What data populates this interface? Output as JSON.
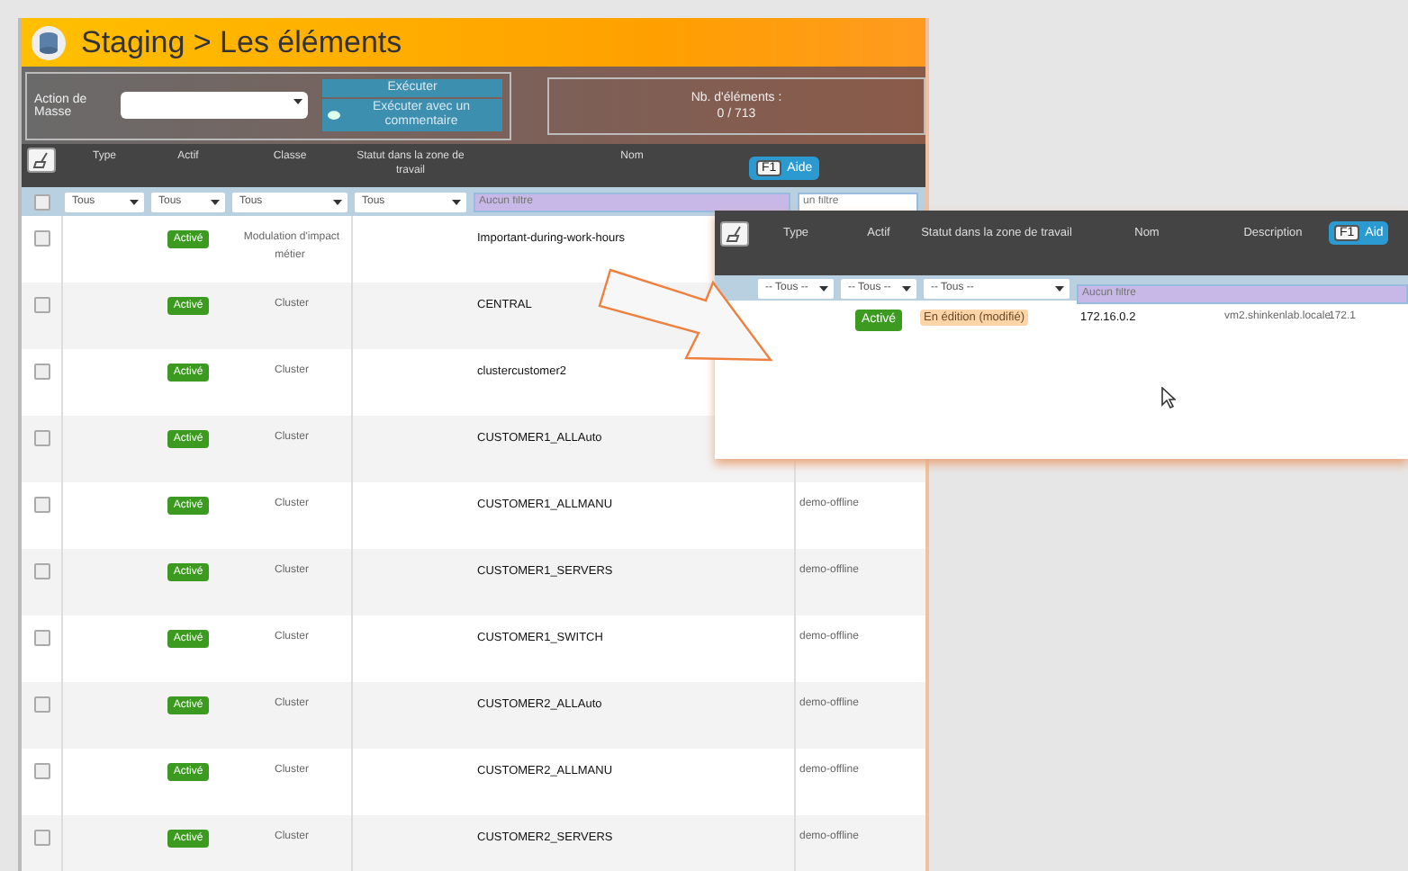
{
  "page_title": "Staging > Les éléments",
  "mass_action": {
    "label": "Action de Masse",
    "buttons": [
      "Exécuter",
      "Exécuter avec un commentaire"
    ]
  },
  "count": {
    "label": "Nb. d'éléments :",
    "value": "0 / 713"
  },
  "table": {
    "columns": [
      "Type",
      "Actif",
      "Classe",
      "Statut dans la zone de travail",
      "Nom"
    ],
    "help_button": {
      "key": "F1",
      "label": "Aide"
    },
    "select_all_checked": false,
    "filters": [
      {
        "kind": "select",
        "text": "Tous"
      },
      {
        "kind": "select",
        "text": "Tous"
      },
      {
        "kind": "select",
        "text": "Tous"
      },
      {
        "kind": "select",
        "text": "Tous"
      },
      {
        "kind": "text",
        "placeholder": "Aucun filtre"
      },
      {
        "kind": "text",
        "placeholder": "un filtre"
      }
    ],
    "rows": [
      {
        "checked": false,
        "active": "Activé",
        "class": "Modulation d'impact métier",
        "name": "Important-during-work-hours"
      },
      {
        "checked": false,
        "active": "Activé",
        "class": "Cluster",
        "name": "CENTRAL"
      },
      {
        "checked": false,
        "active": "Activé",
        "class": "Cluster",
        "name": "clustercustomer2"
      },
      {
        "checked": false,
        "active": "Activé",
        "class": "Cluster",
        "name": "CUSTOMER1_ALLAuto"
      },
      {
        "checked": false,
        "active": "Activé",
        "class": "Cluster",
        "name": "CUSTOMER1_ALLMANU",
        "description": "demo-offline"
      },
      {
        "checked": false,
        "active": "Activé",
        "class": "Cluster",
        "name": "CUSTOMER1_SERVERS",
        "description": "demo-offline"
      },
      {
        "checked": false,
        "active": "Activé",
        "class": "Cluster",
        "name": "CUSTOMER1_SWITCH",
        "description": "demo-offline"
      },
      {
        "checked": false,
        "active": "Activé",
        "class": "Cluster",
        "name": "CUSTOMER2_ALLAuto",
        "description": "demo-offline"
      },
      {
        "checked": false,
        "active": "Activé",
        "class": "Cluster",
        "name": "CUSTOMER2_ALLMANU",
        "description": "demo-offline"
      },
      {
        "checked": false,
        "active": "Activé",
        "class": "Cluster",
        "name": "CUSTOMER2_SERVERS",
        "description": "demo-offline"
      }
    ]
  },
  "inset": {
    "columns": [
      "Type",
      "Actif",
      "Statut dans la zone de travail",
      "Nom",
      "Description"
    ],
    "help_button": {
      "key": "F1",
      "label": "Aid"
    },
    "filters": [
      {
        "kind": "select",
        "text": "-- Tous --"
      },
      {
        "kind": "select",
        "text": "-- Tous --"
      },
      {
        "kind": "select",
        "text": "-- Tous --"
      },
      {
        "kind": "text",
        "placeholder": "Aucun filtre"
      }
    ],
    "row": {
      "active": "Activé",
      "status": "En édition (modifié)",
      "name": "172.16.0.2",
      "description": "vm2.shinkenlab.locale",
      "address": "172.1"
    }
  }
}
